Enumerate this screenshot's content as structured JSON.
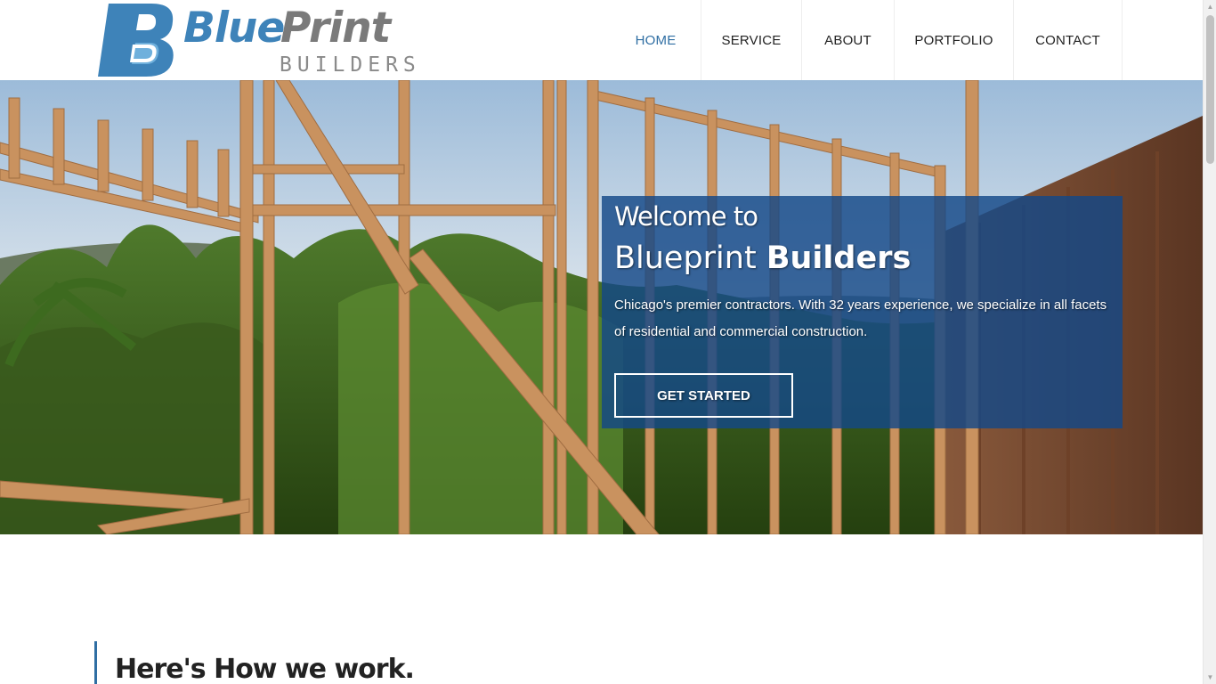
{
  "brand": {
    "name_part1": "Blue",
    "name_part2": "Print",
    "tagline": "BUILDERS",
    "colors": {
      "primary": "#3e83b9",
      "secondary": "#7a7a7a",
      "panel": "#144887"
    }
  },
  "nav": {
    "items": [
      {
        "label": "HOME",
        "active": true
      },
      {
        "label": "SERVICE",
        "active": false
      },
      {
        "label": "ABOUT",
        "active": false
      },
      {
        "label": "PORTFOLIO",
        "active": false
      },
      {
        "label": "CONTACT",
        "active": false
      }
    ]
  },
  "hero": {
    "welcome": "Welcome to",
    "title_light": "Blueprint",
    "title_bold": "Builders",
    "text": "Chicago's premier contractors. With 32 years experience, we specialize in all facets of residential and commercial construction.",
    "button_label": "GET STARTED"
  },
  "section": {
    "title": "Here's How we work."
  },
  "icons": [
    "scroll-up-arrow-icon",
    "scroll-down-arrow-icon"
  ]
}
